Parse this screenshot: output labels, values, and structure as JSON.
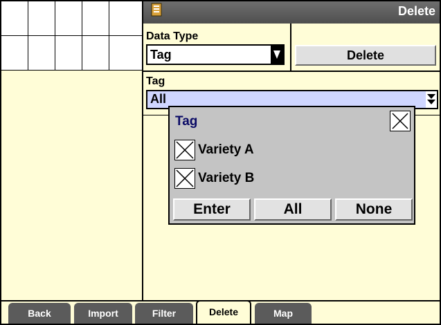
{
  "header": {
    "title": "Delete"
  },
  "data_type": {
    "label": "Data Type",
    "value": "Tag"
  },
  "delete_button": {
    "label": "Delete"
  },
  "tag": {
    "label": "Tag",
    "value": "All"
  },
  "dialog": {
    "title": "Tag",
    "options": [
      {
        "label": "Variety A",
        "checked": true
      },
      {
        "label": "Variety B",
        "checked": true
      }
    ],
    "buttons": {
      "enter": "Enter",
      "all": "All",
      "none": "None"
    }
  },
  "tabs": [
    {
      "label": "Back"
    },
    {
      "label": "Import"
    },
    {
      "label": "Filter"
    },
    {
      "label": "Delete",
      "active": true
    },
    {
      "label": "Map"
    }
  ],
  "colors": {
    "background": "#fffdd7",
    "titlebar": "#5a5a5a",
    "dialog": "#c4c4c4",
    "tag_field": "#cfd6ff",
    "dialog_title": "#0b0b66"
  }
}
